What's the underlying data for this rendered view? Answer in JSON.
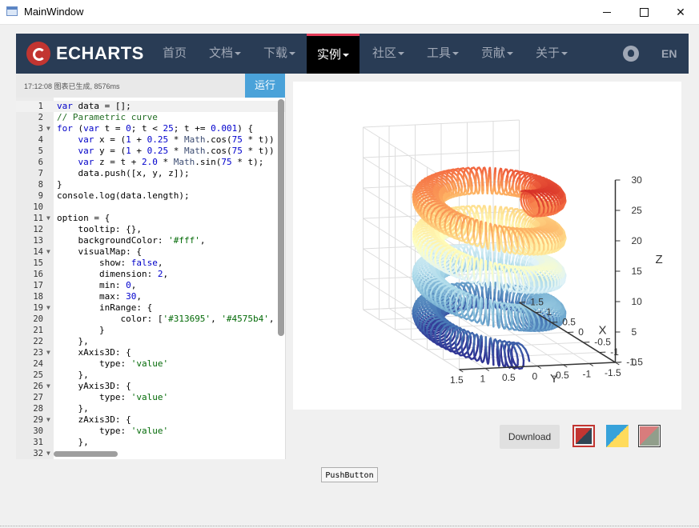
{
  "window": {
    "title": "MainWindow"
  },
  "nav": {
    "logo_text": "ECHARTS",
    "items": [
      {
        "label": "首页",
        "caret": false
      },
      {
        "label": "文档",
        "caret": true
      },
      {
        "label": "下载",
        "caret": true
      },
      {
        "label": "实例",
        "caret": true,
        "active": true
      },
      {
        "label": "社区",
        "caret": true
      },
      {
        "label": "工具",
        "caret": true
      },
      {
        "label": "贡献",
        "caret": true
      },
      {
        "label": "关于",
        "caret": true
      }
    ],
    "lang": "EN"
  },
  "editor": {
    "status": "17:12:08   图表已生成, 8576ms",
    "run_label": "运行",
    "lines": [
      "var data = [];",
      "// Parametric curve",
      "for (var t = 0; t < 25; t += 0.001) {",
      "    var x = (1 + 0.25 * Math.cos(75 * t))",
      "    var y = (1 + 0.25 * Math.cos(75 * t))",
      "    var z = t + 2.0 * Math.sin(75 * t);",
      "    data.push([x, y, z]);",
      "}",
      "console.log(data.length);",
      "",
      "option = {",
      "    tooltip: {},",
      "    backgroundColor: '#fff',",
      "    visualMap: {",
      "        show: false,",
      "        dimension: 2,",
      "        min: 0,",
      "        max: 30,",
      "        inRange: {",
      "            color: ['#313695', '#4575b4',",
      "        }",
      "    },",
      "    xAxis3D: {",
      "        type: 'value'",
      "    },",
      "    yAxis3D: {",
      "        type: 'value'",
      "    },",
      "    zAxis3D: {",
      "        type: 'value'",
      "    },",
      ""
    ],
    "folds": [
      3,
      11,
      14,
      19,
      23,
      26,
      29,
      32
    ]
  },
  "chart_data": {
    "type": "line3d",
    "axes": {
      "z": {
        "name": "Z",
        "ticks": [
          "0",
          "5",
          "10",
          "15",
          "20",
          "25",
          "30"
        ],
        "range": [
          0,
          30
        ]
      },
      "x": {
        "name": "X",
        "ticks": [
          "-1.5",
          "-1",
          "-0.5",
          "0",
          "0.5",
          "1",
          "1.5"
        ],
        "range": [
          -1.5,
          1.5
        ]
      },
      "y": {
        "name": "Y",
        "ticks": [
          "1.5",
          "1",
          "0.5",
          "0",
          "-0.5",
          "-1",
          "-1.5"
        ],
        "range": [
          -1.5,
          1.5
        ]
      }
    },
    "visual_map": {
      "dimension": "z",
      "min": 0,
      "max": 30,
      "colors": [
        "#313695",
        "#4575b4",
        "#74add1",
        "#abd9e9",
        "#e0f3f8",
        "#ffffbf",
        "#fee090",
        "#fdae61",
        "#f46d43",
        "#d73027",
        "#a50026"
      ]
    },
    "curve": {
      "x": "(1 + 0.25*cos(75t)) * cos(t)",
      "y": "(1 + 0.25*cos(75t)) * sin(t)",
      "z": "t + 2.0*sin(75t)",
      "t_range": [
        0,
        25
      ]
    }
  },
  "toolbar": {
    "download_label": "Download",
    "themes": [
      {
        "name": "default",
        "colors": [
          "#c23531",
          "#2f4554"
        ],
        "selected": true
      },
      {
        "name": "light",
        "colors": [
          "#37a2da",
          "#ffdb5c"
        ],
        "selected": false
      },
      {
        "name": "vintage",
        "colors": [
          "#d87c7c",
          "#919e8b"
        ],
        "selected": false
      }
    ]
  },
  "push_button": {
    "label": "PushButton"
  }
}
